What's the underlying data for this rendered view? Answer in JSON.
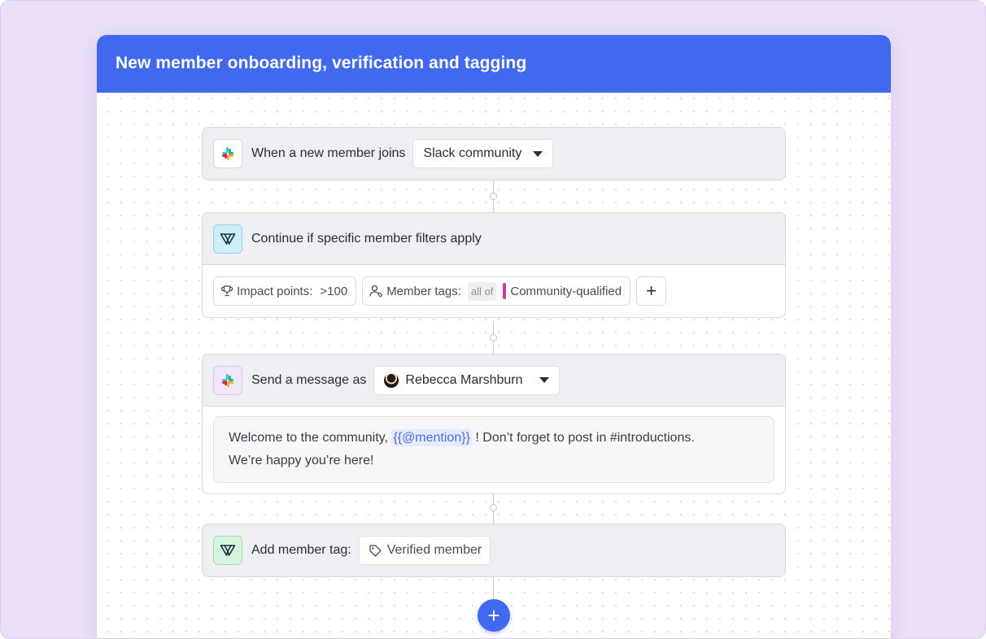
{
  "workflow": {
    "title": "New member onboarding, verification and tagging"
  },
  "trigger": {
    "label": "When a new member joins",
    "source_value": "Slack community",
    "icon": "slack-icon"
  },
  "filter": {
    "label": "Continue if specific member filters apply",
    "icon": "filter-icon",
    "impact_label": "Impact points:",
    "impact_value": ">100",
    "tags_label": "Member tags:",
    "tags_operator": "all of",
    "tag_value": "Community-qualified",
    "tag_color": "#d4389a",
    "add_label": "+"
  },
  "message": {
    "label": "Send a message as",
    "sender": "Rebecca Marshburn",
    "icon": "slack-icon",
    "text_before": "Welcome to the community,",
    "mention": "{{@mention}}",
    "text_after": "! Don’t forget to post in #introductions.",
    "text_line2": "We’re happy you’re here!"
  },
  "tag_action": {
    "label": "Add member tag:",
    "tag": "Verified member",
    "icon": "filter-icon"
  },
  "add_step": {
    "label": "+"
  },
  "colors": {
    "accent": "#4069f0",
    "background": "#ebe0f8"
  }
}
